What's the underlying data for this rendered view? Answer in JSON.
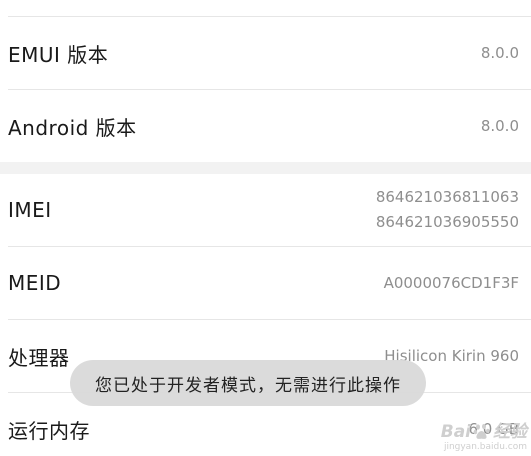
{
  "rows": [
    {
      "label": "EMUI 版本",
      "value": "8.0.0"
    },
    {
      "label": "Android 版本",
      "value": "8.0.0"
    },
    {
      "label": "IMEI",
      "values": [
        "864621036811063",
        "864621036905550"
      ]
    },
    {
      "label": "MEID",
      "value": "A0000076CD1F3F"
    },
    {
      "label": "处理器",
      "value": "Hisilicon Kirin 960"
    },
    {
      "label": "运行内存",
      "value": "6.0 GB"
    }
  ],
  "toast": {
    "message": "您已处于开发者模式，无需进行此操作"
  },
  "watermark": {
    "brand_left": "Bai",
    "brand_right": "经验",
    "url": "jingyan.baidu.com",
    "icon": "baidu-paw-icon"
  },
  "colors": {
    "label": "#1a1a1a",
    "value": "#8e8e8e",
    "divider": "#e6e6e6",
    "section_gap": "#f2f2f2",
    "toast_bg": "#dadada"
  }
}
